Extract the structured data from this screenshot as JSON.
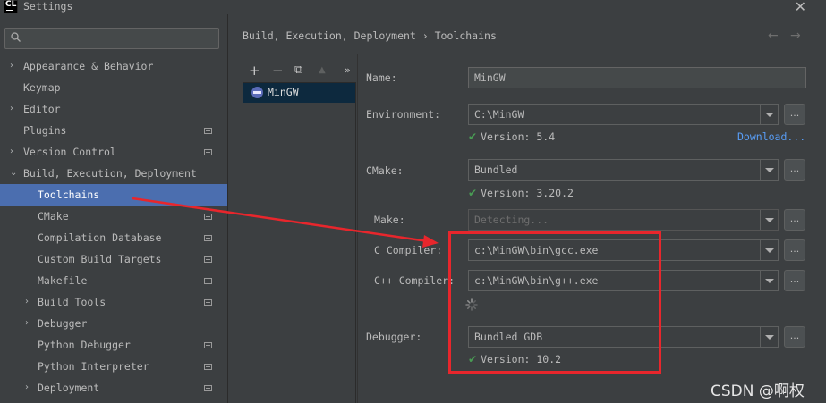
{
  "window": {
    "icon_text": "CL",
    "title": "Settings",
    "close_glyph": "✕"
  },
  "search": {
    "placeholder": "",
    "icon": "search-icon"
  },
  "sidebar": {
    "items": [
      {
        "label": "Appearance & Behavior",
        "arrow": "›",
        "indent": 0,
        "badge": false,
        "selected": false
      },
      {
        "label": "Keymap",
        "arrow": "",
        "indent": 0,
        "badge": false,
        "selected": false
      },
      {
        "label": "Editor",
        "arrow": "›",
        "indent": 0,
        "badge": false,
        "selected": false
      },
      {
        "label": "Plugins",
        "arrow": "",
        "indent": 0,
        "badge": true,
        "selected": false
      },
      {
        "label": "Version Control",
        "arrow": "›",
        "indent": 0,
        "badge": true,
        "selected": false
      },
      {
        "label": "Build, Execution, Deployment",
        "arrow": "⌄",
        "indent": 0,
        "badge": false,
        "selected": false
      },
      {
        "label": "Toolchains",
        "arrow": "",
        "indent": 1,
        "badge": false,
        "selected": true
      },
      {
        "label": "CMake",
        "arrow": "",
        "indent": 1,
        "badge": true,
        "selected": false
      },
      {
        "label": "Compilation Database",
        "arrow": "",
        "indent": 1,
        "badge": true,
        "selected": false
      },
      {
        "label": "Custom Build Targets",
        "arrow": "",
        "indent": 1,
        "badge": true,
        "selected": false
      },
      {
        "label": "Makefile",
        "arrow": "",
        "indent": 1,
        "badge": true,
        "selected": false
      },
      {
        "label": "Build Tools",
        "arrow": "›",
        "indent": 1,
        "badge": true,
        "selected": false
      },
      {
        "label": "Debugger",
        "arrow": "›",
        "indent": 1,
        "badge": false,
        "selected": false
      },
      {
        "label": "Python Debugger",
        "arrow": "",
        "indent": 1,
        "badge": true,
        "selected": false
      },
      {
        "label": "Python Interpreter",
        "arrow": "",
        "indent": 1,
        "badge": true,
        "selected": false
      },
      {
        "label": "Deployment",
        "arrow": "›",
        "indent": 1,
        "badge": true,
        "selected": false
      }
    ]
  },
  "header": {
    "breadcrumb": "Build, Execution, Deployment › Toolchains",
    "back_glyph": "←",
    "forward_glyph": "→"
  },
  "toolchain_toolbar": {
    "add": "+",
    "remove": "−",
    "copy": "⧉",
    "up": "▲",
    "more": "»"
  },
  "toolchains": {
    "items": [
      {
        "label": "MinGW",
        "icon": "gnu-icon"
      }
    ]
  },
  "form": {
    "name_label": "Name:",
    "name_value": "MinGW",
    "environment_label": "Environment:",
    "environment_value": "C:\\MinGW",
    "environment_version": "Version: 5.4",
    "download_link": "Download...",
    "cmake_label": "CMake:",
    "cmake_value": "Bundled",
    "cmake_version": "Version: 3.20.2",
    "make_label": "Make:",
    "make_value": "Detecting...",
    "c_compiler_label": "C Compiler:",
    "c_compiler_value": "c:\\MinGW\\bin\\gcc.exe",
    "cpp_compiler_label": "C++ Compiler:",
    "cpp_compiler_value": "c:\\MinGW\\bin\\g++.exe",
    "debugger_label": "Debugger:",
    "debugger_value": "Bundled GDB",
    "debugger_version": "Version: 10.2",
    "browse_glyph": "...",
    "check_glyph": "✔"
  },
  "watermark": "CSDN @啊权",
  "colors": {
    "background": "#3c3f41",
    "selection": "#4b6eaf",
    "annotation_red": "#e8262c",
    "check_green": "#499c54",
    "link_blue": "#589df6"
  }
}
